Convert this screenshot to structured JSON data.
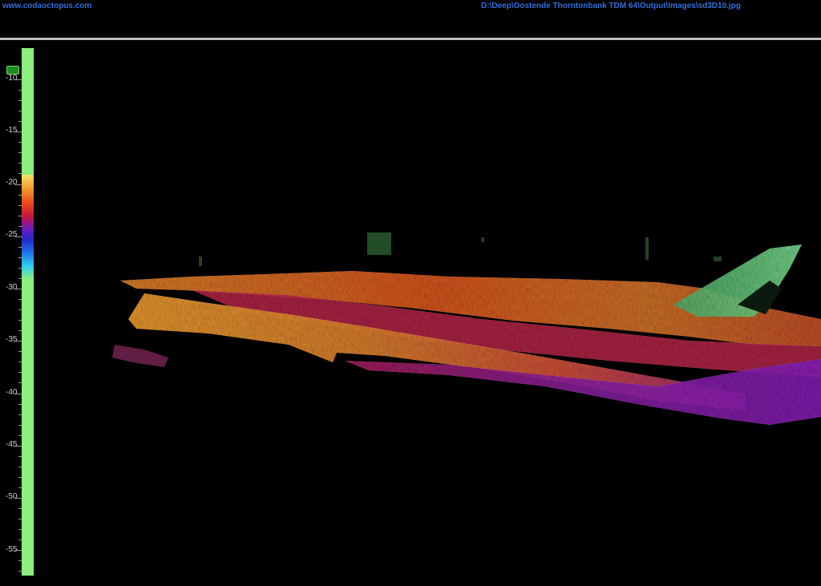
{
  "header": {
    "website": "www.codaoctopus.com",
    "file_path": "D:\\Deep\\Oostende Thorntonbank TDM 64\\Output\\Images\\sd3D10.jpg"
  },
  "depth_scale": {
    "labels": [
      "-10",
      "-15",
      "-20",
      "-25",
      "-30",
      "-35",
      "-40",
      "-45",
      "-50",
      "-55"
    ],
    "bar_color": "#8cef7f"
  },
  "icons": {
    "marker": "depth-marker-icon"
  }
}
